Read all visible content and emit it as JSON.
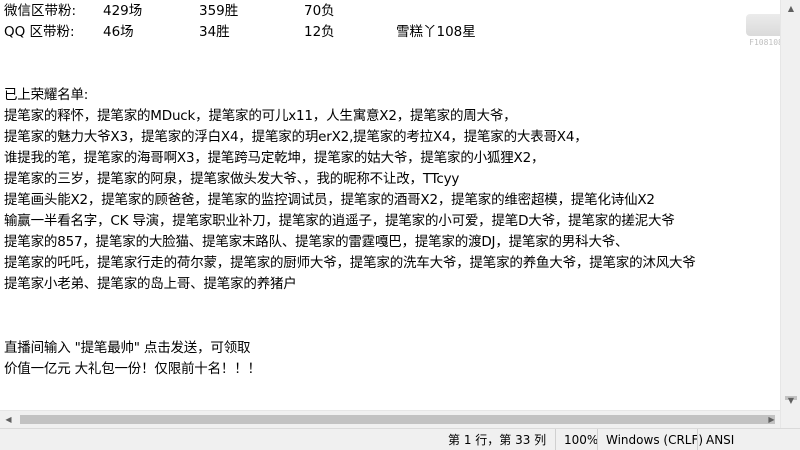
{
  "stats": {
    "wechat": {
      "label": "微信区带粉:",
      "games": "429场",
      "wins": "359胜",
      "losses": "70负"
    },
    "qq": {
      "label": "QQ 区带粉:",
      "games": "46场",
      "wins": "34胜",
      "losses": "12负",
      "tag": "雪糕丫108星"
    }
  },
  "honor_title": "已上荣耀名单:",
  "honor_lines": [
    " 提笔家的释怀，提笔家的MDuck，提笔家的可儿x11，人生寓意X2，提笔家的周大爷，",
    "提笔家的魅力大爷X3，提笔家的浮白X4，提笔家的玥erX2,提笔家的考拉X4，提笔家的大表哥X4，",
    "谁提我的笔，提笔家的海哥啊X3，提笔跨马定乾坤，提笔家的姑大爷，提笔家的小狐狸X2，",
    "提笔家的三岁，提笔家的阿泉，提笔家做头发大爷、，我的昵称不让改，TTcyy",
    "提笔画头能X2，提笔家的顾爸爸，提笔家的监控调试员，提笔家的酒哥X2，提笔家的维密超模，提笔化诗仙X2",
    "输赢一半看名字，CK 导演，提笔家职业补刀，提笔家的逍遥子，提笔家的小可爱，提笔D大爷，提笔家的搓泥大爷",
    "提笔家的857，提笔家的大脸猫、提笔家末路队、提笔家的雷霆嘎巴，提笔家的渡DJ，提笔家的男科大爷、",
    "提笔家的吒吒，提笔家行走的荷尔蒙，提笔家的厨师大爷，提笔家的洗车大爷，提笔家的养鱼大爷，提笔家的沐风大爷",
    "提笔家小老弟、提笔家的岛上哥、提笔家的养猪户"
  ],
  "promo": {
    "line1": "直播间输入 \"提笔最帅\" 点击发送，可领取",
    "line2": "价值一亿元 大礼包一份！仅限前十名！！！"
  },
  "statusbar": {
    "position": "第 1 行，第 33 列",
    "zoom": "100%",
    "line_ending": "Windows (CRLF)",
    "encoding": "ANSI"
  },
  "watermark": {
    "id": "F108108"
  }
}
